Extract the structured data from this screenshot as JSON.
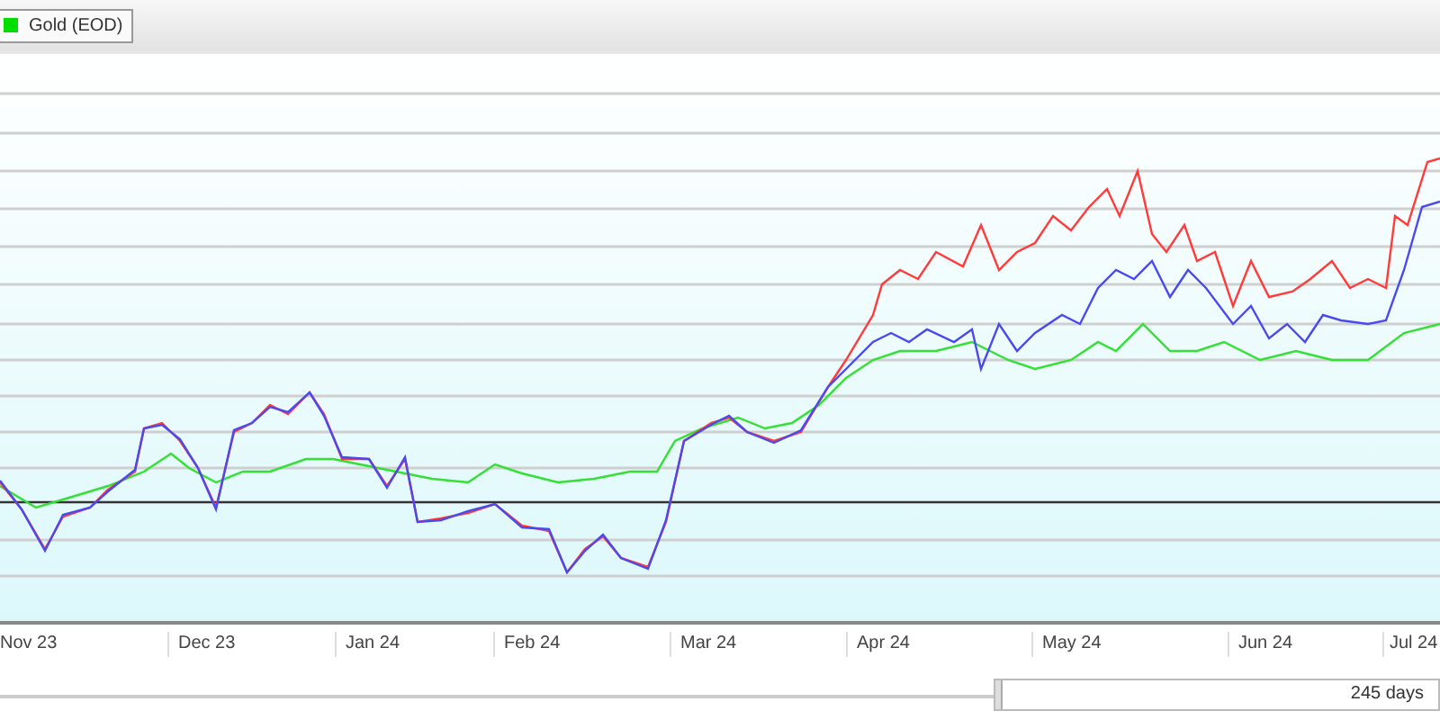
{
  "legend": [
    {
      "label": "Gold (EOD)",
      "color": "#00dd00"
    }
  ],
  "x_axis": {
    "labels": [
      "Nov 23",
      "Dec 23",
      "Jan 24",
      "Feb 24",
      "Mar 24",
      "Apr 24",
      "May 24",
      "Jun 24",
      "Jul 24"
    ]
  },
  "range_selector": {
    "label": "245 days"
  }
}
